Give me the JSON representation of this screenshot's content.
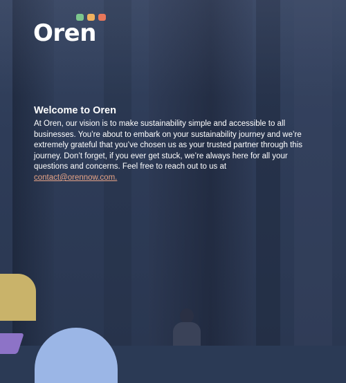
{
  "brand": {
    "name": "Oren",
    "dot_colors": [
      "#7cc68d",
      "#f0b15e",
      "#e8775a"
    ]
  },
  "welcome": {
    "title": "Welcome to Oren",
    "body": "At Oren, our vision is to make sustainability simple and accessible to all businesses. You’re about to embark on your sustainability journey and we’re extremely grateful that you’ve chosen us as your trusted partner through this journey. Don’t forget, if you ever get stuck, we’re always here for all your questions and concerns. Feel free to reach out to us at ",
    "contact_email": "contact@orennow.com."
  },
  "colors": {
    "link": "#e8a487",
    "background": "#2b3a55"
  }
}
